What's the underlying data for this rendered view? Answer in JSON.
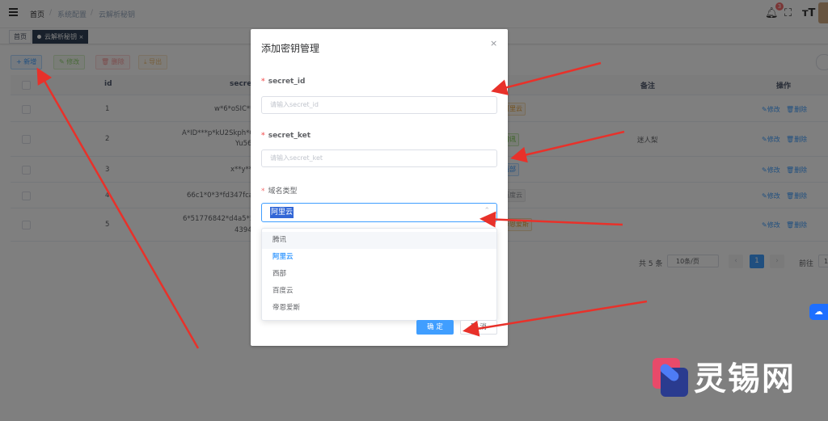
{
  "header": {
    "breadcrumb": [
      "首页",
      "系统配置",
      "云解析秘钥"
    ],
    "notification_count": "3",
    "icons": [
      "bell-icon",
      "fullscreen-icon",
      "font-size-icon"
    ]
  },
  "tags": {
    "home": "首页",
    "active": "云解析秘钥",
    "close": "×"
  },
  "toolbar": {
    "add": "+ 新增",
    "edit": "✎ 修改",
    "delete": "🗑 删除",
    "export": "⤓ 导出"
  },
  "table": {
    "columns": {
      "id": "id",
      "secret": "secret_",
      "remark": "备注",
      "ops": "操作"
    },
    "rows": [
      {
        "id": "1",
        "secret": "w*6*oSIC**p",
        "type": "阿里云",
        "remark": "",
        "edit": "✎修改",
        "delete": "🗑删除"
      },
      {
        "id": "2",
        "secret": "A*ID***p*kU2Skph*Gc",
        "secret2": "Yu56",
        "type": "腾讯",
        "remark": "迷人梨",
        "edit": "✎修改",
        "delete": "🗑删除"
      },
      {
        "id": "3",
        "secret": "x**y**2",
        "type": "西部",
        "remark": "",
        "edit": "✎修改",
        "delete": "🗑删除"
      },
      {
        "id": "4",
        "secret": "66c1*0*3*fd347fca*c",
        "type": "百度云",
        "remark": "",
        "edit": "✎修改",
        "delete": "🗑删除"
      },
      {
        "id": "5",
        "secret": "6*51776842*d4a5*5a",
        "secret2": "4394",
        "type": "帝恩爱斯",
        "remark": "",
        "edit": "✎修改",
        "delete": "🗑删除"
      }
    ]
  },
  "pagination": {
    "total": "共 5 条",
    "page_size": "10条/页",
    "prev": "‹",
    "current": "1",
    "next": "›",
    "goto": "前往",
    "goto_value": "1"
  },
  "dialog": {
    "title": "添加密钥管理",
    "close": "×",
    "secret_id_label": "secret_id",
    "secret_id_placeholder": "请输入secret_id",
    "secret_ket_label": "secret_ket",
    "secret_ket_placeholder": "请输入secret_ket",
    "domain_type_label": "域名类型",
    "domain_type_value": "阿里云",
    "options": [
      "腾讯",
      "阿里云",
      "西部",
      "百度云",
      "帝恩爱斯"
    ],
    "ok": "确 定",
    "cancel": "取 消"
  },
  "watermark": {
    "text": "灵锡网"
  },
  "colors": {
    "primary": "#409eff",
    "danger": "#f56c6c",
    "arrow": "#e8312a"
  }
}
